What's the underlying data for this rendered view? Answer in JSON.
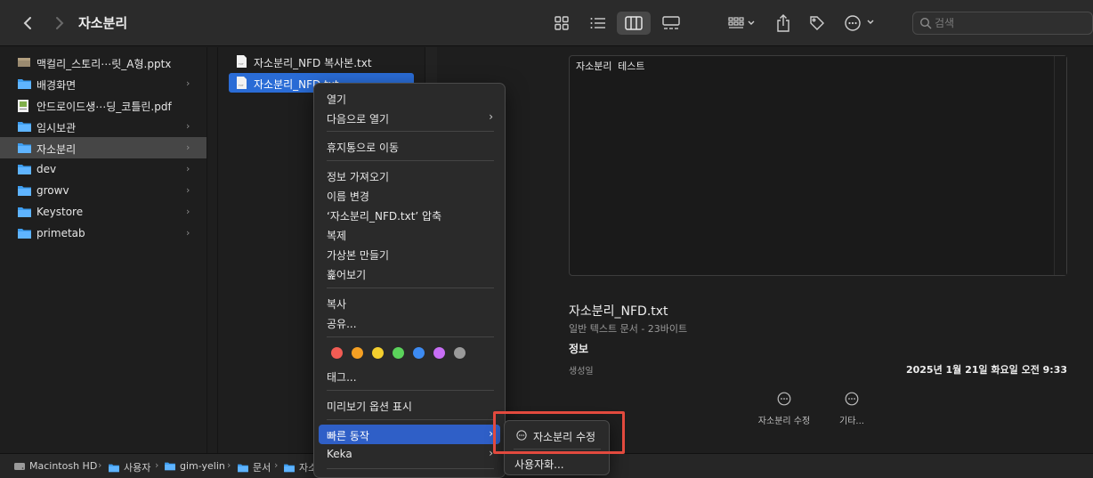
{
  "window": {
    "title": "자소분리"
  },
  "toolbar": {
    "back_icon": "chevron-left-icon",
    "forward_icon": "chevron-right-icon",
    "view_modes": [
      "icon-view",
      "list-view",
      "column-view",
      "gallery-view"
    ],
    "active_view": "column-view",
    "search_placeholder": "검색"
  },
  "sidebar": {
    "items": [
      {
        "label": "맥컬리_스토리⋯릿_A형.pptx",
        "icon": "document-icon",
        "chevron": false
      },
      {
        "label": "배경화면",
        "icon": "folder-icon",
        "chevron": true
      },
      {
        "label": "안드로이드생⋯딩_코틀린.pdf",
        "icon": "pdf-icon",
        "chevron": false
      },
      {
        "label": "임시보관",
        "icon": "folder-icon",
        "chevron": true
      },
      {
        "label": "자소분리",
        "icon": "folder-icon",
        "chevron": true,
        "selected": true
      },
      {
        "label": "dev",
        "icon": "folder-icon",
        "chevron": true
      },
      {
        "label": "growv",
        "icon": "folder-icon",
        "chevron": true
      },
      {
        "label": "Keystore",
        "icon": "folder-icon",
        "chevron": true
      },
      {
        "label": "primetab",
        "icon": "folder-icon",
        "chevron": true
      }
    ]
  },
  "files": {
    "items": [
      {
        "label": "자소분리_NFD 복사본.txt"
      },
      {
        "label": "자소분리_NFD.txt",
        "selected": true
      }
    ]
  },
  "preview": {
    "content": "자소분리 테스트",
    "name": "자소분리_NFD.txt",
    "kind": "일반 텍스트 문서 - 23바이트",
    "info_heading": "정보",
    "created_label": "생성일",
    "created_value": "2025년 1월 21일 화요일 오전 9:33",
    "actions": [
      {
        "label": "자소분리 수정"
      },
      {
        "label": "기타..."
      }
    ]
  },
  "pathbar": {
    "crumbs": [
      "Macintosh HD",
      "사용자",
      "gim-yelin",
      "문서",
      "자소"
    ]
  },
  "context_menu": {
    "open": "열기",
    "open_with": "다음으로 열기",
    "move_to_trash": "휴지통으로 이동",
    "get_info": "정보 가져오기",
    "rename": "이름 변경",
    "compress": "‘자소분리_NFD.txt’ 압축",
    "duplicate": "복제",
    "make_alias": "가상본 만들기",
    "quick_look": "훑어보기",
    "copy": "복사",
    "share": "공유...",
    "tags_label": "태그...",
    "tag_colors": [
      "#f25c54",
      "#f5a023",
      "#f4cf2e",
      "#5bd35b",
      "#3d8bf2",
      "#c86ef5",
      "#9a9a9a"
    ],
    "show_preview_options": "미리보기 옵션 표시",
    "quick_actions": "빠른 동작",
    "keka": "Keka"
  },
  "submenu": {
    "item1": "자소분리 수정",
    "item2": "사용자화..."
  },
  "colors": {
    "accent": "#2f5fc7",
    "highlight_box": "#e24a3e"
  }
}
